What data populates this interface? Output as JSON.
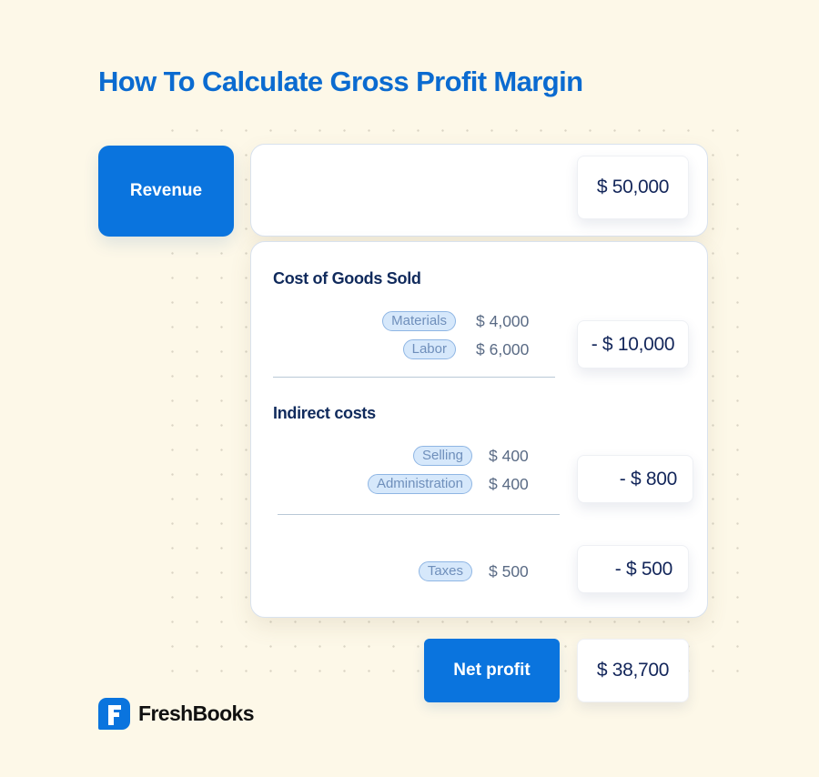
{
  "title": "How To Calculate Gross Profit Margin",
  "revenue": {
    "label": "Revenue",
    "value": "$ 50,000"
  },
  "cost_of_goods_sold": {
    "heading": "Cost of Goods Sold",
    "items": [
      {
        "tag": "Materials",
        "amount": "$ 4,000"
      },
      {
        "tag": "Labor",
        "amount": "$ 6,000"
      }
    ],
    "total": "- $ 10,000"
  },
  "indirect_costs": {
    "heading": "Indirect costs",
    "items": [
      {
        "tag": "Selling",
        "amount": "$ 400"
      },
      {
        "tag": "Administration",
        "amount": "$ 400"
      }
    ],
    "total": "- $ 800"
  },
  "taxes": {
    "items": [
      {
        "tag": "Taxes",
        "amount": "$ 500"
      }
    ],
    "total": "- $ 500"
  },
  "net_profit": {
    "label": "Net profit",
    "value": "$ 38,700"
  },
  "brand": {
    "name": "FreshBooks",
    "icon": "freshbooks-logo-icon"
  },
  "colors": {
    "background": "#fdf8e8",
    "accent_blue": "#0a74de",
    "title_blue": "#0b6bd0",
    "navy_text": "#13265a",
    "tag_fill": "#d6e8fb",
    "tag_border": "#8fb6e4"
  }
}
